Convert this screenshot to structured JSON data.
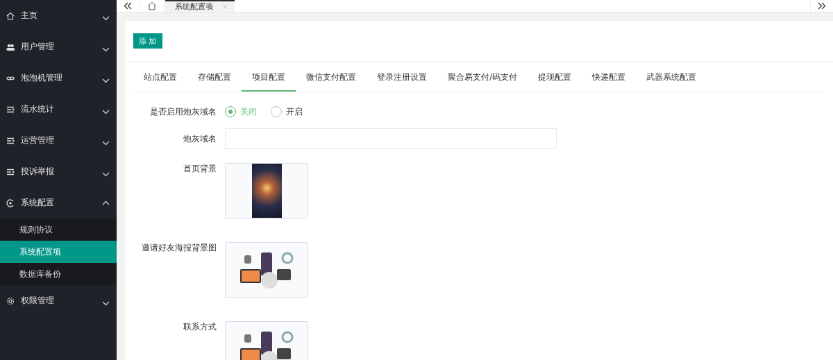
{
  "sidebar": {
    "items": [
      {
        "label": "主页",
        "expanded": false
      },
      {
        "label": "用户管理",
        "expanded": false
      },
      {
        "label": "泡泡机管理",
        "expanded": false
      },
      {
        "label": "流水统计",
        "expanded": false
      },
      {
        "label": "运营管理",
        "expanded": false
      },
      {
        "label": "投诉举报",
        "expanded": false
      },
      {
        "label": "系统配置",
        "expanded": true,
        "children": [
          {
            "label": "规则协议",
            "selected": false
          },
          {
            "label": "系统配置项",
            "selected": true
          },
          {
            "label": "数据库备份",
            "selected": false
          }
        ]
      },
      {
        "label": "权限管理",
        "expanded": false
      }
    ]
  },
  "page_tabs": [
    {
      "label": "系统配置项",
      "selected": true
    }
  ],
  "add_button": "添 加",
  "tabs": [
    {
      "label": "站点配置",
      "selected": false
    },
    {
      "label": "存储配置",
      "selected": false
    },
    {
      "label": "项目配置",
      "selected": true
    },
    {
      "label": "微信支付配置",
      "selected": false
    },
    {
      "label": "登录注册设置",
      "selected": false
    },
    {
      "label": "聚合易支付/码支付",
      "selected": false
    },
    {
      "label": "提现配置",
      "selected": false
    },
    {
      "label": "快递配置",
      "selected": false
    },
    {
      "label": "武器系统配置",
      "selected": false
    }
  ],
  "form": [
    {
      "kind": "radio",
      "label": "是否启用炮灰域名",
      "options": [
        {
          "label": "关闭",
          "selected": true
        },
        {
          "label": "开启",
          "selected": false
        }
      ]
    },
    {
      "kind": "input",
      "label": "炮灰域名"
    },
    {
      "kind": "image",
      "label": "首页背景"
    },
    {
      "kind": "image",
      "label": "邀请好友海报背景图"
    },
    {
      "kind": "image",
      "label": "联系方式"
    }
  ]
}
